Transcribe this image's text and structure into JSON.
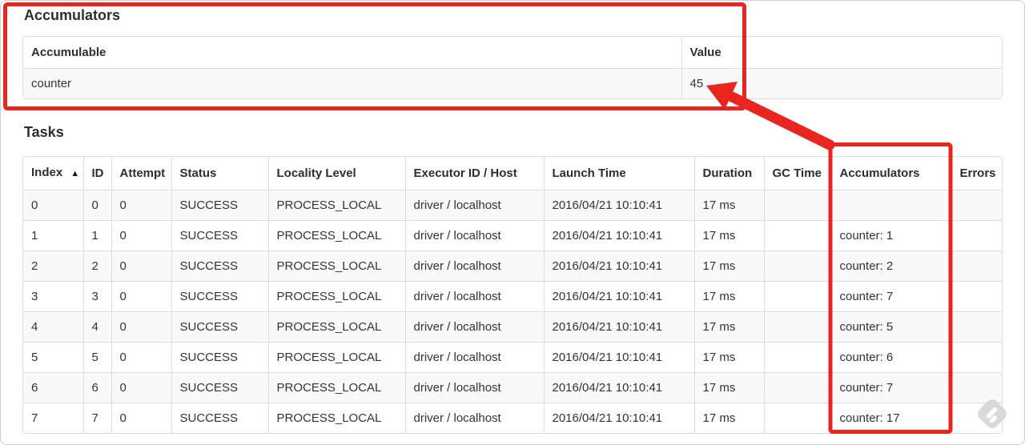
{
  "accumulators_section": {
    "title": "Accumulators",
    "table": {
      "headers": [
        "Accumulable",
        "Value"
      ],
      "rows": [
        [
          "counter",
          "45"
        ]
      ]
    }
  },
  "tasks_section": {
    "title": "Tasks",
    "sort_indicator": "▲",
    "table": {
      "headers": [
        "Index",
        "ID",
        "Attempt",
        "Status",
        "Locality Level",
        "Executor ID / Host",
        "Launch Time",
        "Duration",
        "GC Time",
        "Accumulators",
        "Errors"
      ],
      "rows": [
        [
          "0",
          "0",
          "0",
          "SUCCESS",
          "PROCESS_LOCAL",
          "driver / localhost",
          "2016/04/21 10:10:41",
          "17 ms",
          "",
          "",
          ""
        ],
        [
          "1",
          "1",
          "0",
          "SUCCESS",
          "PROCESS_LOCAL",
          "driver / localhost",
          "2016/04/21 10:10:41",
          "17 ms",
          "",
          "counter: 1",
          ""
        ],
        [
          "2",
          "2",
          "0",
          "SUCCESS",
          "PROCESS_LOCAL",
          "driver / localhost",
          "2016/04/21 10:10:41",
          "17 ms",
          "",
          "counter: 2",
          ""
        ],
        [
          "3",
          "3",
          "0",
          "SUCCESS",
          "PROCESS_LOCAL",
          "driver / localhost",
          "2016/04/21 10:10:41",
          "17 ms",
          "",
          "counter: 7",
          ""
        ],
        [
          "4",
          "4",
          "0",
          "SUCCESS",
          "PROCESS_LOCAL",
          "driver / localhost",
          "2016/04/21 10:10:41",
          "17 ms",
          "",
          "counter: 5",
          ""
        ],
        [
          "5",
          "5",
          "0",
          "SUCCESS",
          "PROCESS_LOCAL",
          "driver / localhost",
          "2016/04/21 10:10:41",
          "17 ms",
          "",
          "counter: 6",
          ""
        ],
        [
          "6",
          "6",
          "0",
          "SUCCESS",
          "PROCESS_LOCAL",
          "driver / localhost",
          "2016/04/21 10:10:41",
          "17 ms",
          "",
          "counter: 7",
          ""
        ],
        [
          "7",
          "7",
          "0",
          "SUCCESS",
          "PROCESS_LOCAL",
          "driver / localhost",
          "2016/04/21 10:10:41",
          "17 ms",
          "",
          "counter: 17",
          ""
        ]
      ]
    }
  },
  "annotations": {
    "highlight_color": "#e8251e"
  },
  "icons": {
    "sort_ascending": "▲",
    "watermark": "feedly-logo"
  }
}
